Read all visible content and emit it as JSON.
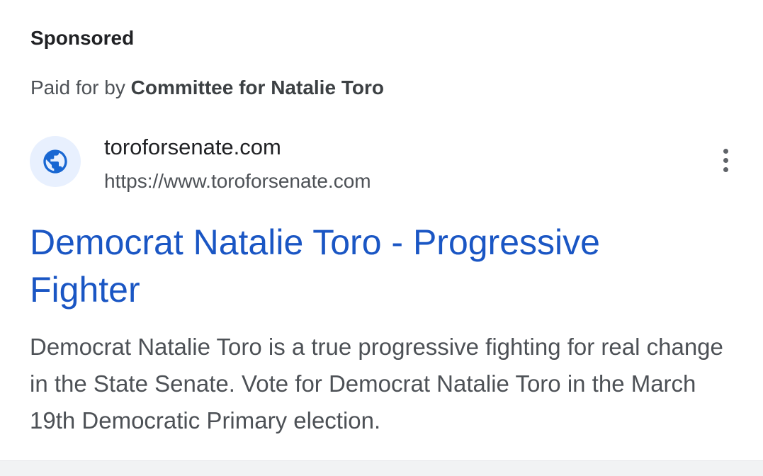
{
  "ad": {
    "label": "Sponsored",
    "paid_prefix": "Paid for by ",
    "sponsor": "Committee for Natalie Toro",
    "site_name": "toroforsenate.com",
    "site_url": "https://www.toroforsenate.com",
    "site_icon": "globe-icon",
    "headline": "Democrat Natalie Toro - Progressive Fighter",
    "description": "Democrat Natalie Toro is a true progressive fighting for real change in the State Senate. Vote for Democrat Natalie Toro in the March 19th Democratic Primary election."
  },
  "menu": {
    "icon": "more-vertical-icon"
  },
  "colors": {
    "link_blue": "#1a56c4",
    "icon_blue": "#1967d2",
    "icon_bg": "#e8f0fe",
    "secondary_text": "#4d5156",
    "primary_text": "#202124"
  }
}
